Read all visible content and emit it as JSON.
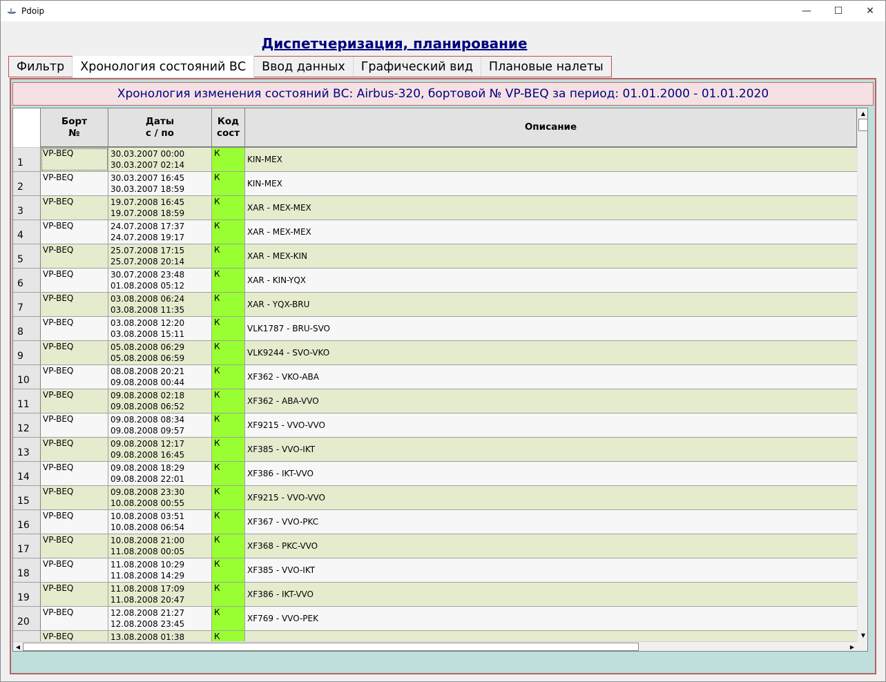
{
  "window": {
    "title": "Pdoip",
    "minimize_glyph": "—",
    "maximize_glyph": "☐",
    "close_glyph": "✕"
  },
  "page_title": "Диспетчеризация, планирование",
  "tabs": [
    {
      "label": "Фильтр",
      "active": false
    },
    {
      "label": "Хронология состояний ВС",
      "active": true
    },
    {
      "label": "Ввод данных",
      "active": false
    },
    {
      "label": "Графический вид",
      "active": false
    },
    {
      "label": "Плановые налеты",
      "active": false
    }
  ],
  "header_text": "Хронология изменения состояний ВС:  Airbus-320, бортовой № VP-BEQ за период: 01.01.2000 - 01.01.2020",
  "columns": {
    "bort": "Борт\n№",
    "dates": "Даты\nс / по",
    "code": "Код\nсост",
    "desc": "Описание"
  },
  "colors": {
    "code_cell": "#99ff33",
    "row_odd": "#e5ecce",
    "row_even": "#f7f7f7",
    "title": "#000080"
  },
  "rows": [
    {
      "num": "1",
      "bort": "VP-BEQ",
      "from": "30.03.2007 00:00",
      "to": "30.03.2007 02:14",
      "code": "К",
      "desc": "KIN-MEX"
    },
    {
      "num": "2",
      "bort": "VP-BEQ",
      "from": "30.03.2007 16:45",
      "to": "30.03.2007 18:59",
      "code": "К",
      "desc": "KIN-MEX"
    },
    {
      "num": "3",
      "bort": "VP-BEQ",
      "from": "19.07.2008 16:45",
      "to": "19.07.2008 18:59",
      "code": "К",
      "desc": "XAR - MEX-MEX"
    },
    {
      "num": "4",
      "bort": "VP-BEQ",
      "from": "24.07.2008 17:37",
      "to": "24.07.2008 19:17",
      "code": "К",
      "desc": "XAR - MEX-MEX"
    },
    {
      "num": "5",
      "bort": "VP-BEQ",
      "from": "25.07.2008 17:15",
      "to": "25.07.2008 20:14",
      "code": "К",
      "desc": "XAR - MEX-KIN"
    },
    {
      "num": "6",
      "bort": "VP-BEQ",
      "from": "30.07.2008 23:48",
      "to": "01.08.2008 05:12",
      "code": "К",
      "desc": "XAR - KIN-YQX"
    },
    {
      "num": "7",
      "bort": "VP-BEQ",
      "from": "03.08.2008 06:24",
      "to": "03.08.2008 11:35",
      "code": "К",
      "desc": "XAR - YQX-BRU"
    },
    {
      "num": "8",
      "bort": "VP-BEQ",
      "from": "03.08.2008 12:20",
      "to": "03.08.2008 15:11",
      "code": "К",
      "desc": "VLK1787 - BRU-SVO"
    },
    {
      "num": "9",
      "bort": "VP-BEQ",
      "from": "05.08.2008 06:29",
      "to": "05.08.2008 06:59",
      "code": "К",
      "desc": "VLK9244 - SVO-VKO"
    },
    {
      "num": "10",
      "bort": "VP-BEQ",
      "from": "08.08.2008 20:21",
      "to": "09.08.2008 00:44",
      "code": "К",
      "desc": "XF362 - VKO-ABA"
    },
    {
      "num": "11",
      "bort": "VP-BEQ",
      "from": "09.08.2008 02:18",
      "to": "09.08.2008 06:52",
      "code": "К",
      "desc": "XF362 - ABA-VVO"
    },
    {
      "num": "12",
      "bort": "VP-BEQ",
      "from": "09.08.2008 08:34",
      "to": "09.08.2008 09:57",
      "code": "К",
      "desc": "XF9215 - VVO-VVO"
    },
    {
      "num": "13",
      "bort": "VP-BEQ",
      "from": "09.08.2008 12:17",
      "to": "09.08.2008 16:45",
      "code": "К",
      "desc": "XF385 - VVO-IKT"
    },
    {
      "num": "14",
      "bort": "VP-BEQ",
      "from": "09.08.2008 18:29",
      "to": "09.08.2008 22:01",
      "code": "К",
      "desc": "XF386 - IKT-VVO"
    },
    {
      "num": "15",
      "bort": "VP-BEQ",
      "from": "09.08.2008 23:30",
      "to": "10.08.2008 00:55",
      "code": "К",
      "desc": "XF9215 - VVO-VVO"
    },
    {
      "num": "16",
      "bort": "VP-BEQ",
      "from": "10.08.2008 03:51",
      "to": "10.08.2008 06:54",
      "code": "К",
      "desc": "XF367 - VVO-PKC"
    },
    {
      "num": "17",
      "bort": "VP-BEQ",
      "from": "10.08.2008 21:00",
      "to": "11.08.2008 00:05",
      "code": "К",
      "desc": "XF368 - PKC-VVO"
    },
    {
      "num": "18",
      "bort": "VP-BEQ",
      "from": "11.08.2008 10:29",
      "to": "11.08.2008 14:29",
      "code": "К",
      "desc": "XF385 - VVO-IKT"
    },
    {
      "num": "19",
      "bort": "VP-BEQ",
      "from": "11.08.2008 17:09",
      "to": "11.08.2008 20:47",
      "code": "К",
      "desc": "XF386 - IKT-VVO"
    },
    {
      "num": "20",
      "bort": "VP-BEQ",
      "from": "12.08.2008 21:27",
      "to": "12.08.2008 23:45",
      "code": "К",
      "desc": "XF769 - VVO-PEK"
    },
    {
      "num": "",
      "bort": "VP-BEQ",
      "from": "13.08.2008 01:38",
      "to": "",
      "code": "К",
      "desc": ""
    }
  ]
}
